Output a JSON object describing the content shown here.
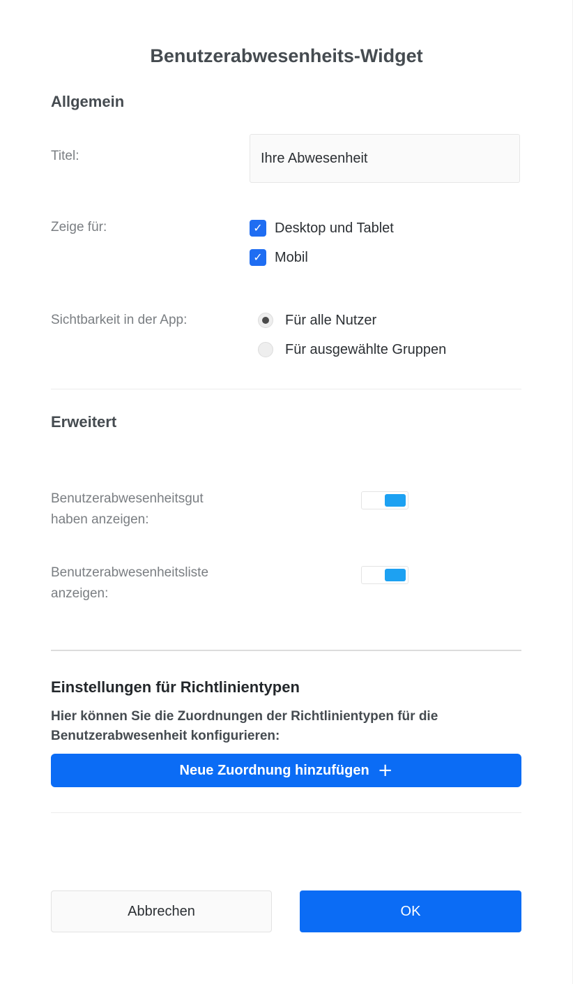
{
  "dialog": {
    "title": "Benutzerabwesenheits-Widget"
  },
  "general": {
    "heading": "Allgemein",
    "title_label": "Titel:",
    "title_value": "Ihre Abwesenheit",
    "show_for_label": "Zeige für:",
    "show_for_options": [
      {
        "label": "Desktop und Tablet",
        "checked": true
      },
      {
        "label": "Mobil",
        "checked": true
      }
    ],
    "visibility_label": "Sichtbarkeit in der App:",
    "visibility_options": [
      {
        "label": "Für alle Nutzer",
        "selected": true
      },
      {
        "label": "Für ausgewählte Gruppen",
        "selected": false
      }
    ]
  },
  "advanced": {
    "heading": "Erweitert",
    "balance_label_line1": "Benutzerabwesenheitsgut",
    "balance_label_line2": "haben anzeigen:",
    "balance_enabled": true,
    "list_label_line1": "Benutzerabwesenheitsliste",
    "list_label_line2": "anzeigen:",
    "list_enabled": true
  },
  "policy": {
    "heading": "Einstellungen für Richtlinientypen",
    "description": "Hier können Sie die Zuordnungen der Richtlinientypen für die Benutzerabwesenheit konfigurieren:",
    "add_button_label": "Neue Zuordnung hinzufügen",
    "add_icon": "plus-icon"
  },
  "footer": {
    "cancel_label": "Abbrechen",
    "ok_label": "OK"
  },
  "colors": {
    "primary": "#0b6cf5",
    "toggle_on": "#1da1f2",
    "checkbox": "#1f6df2"
  }
}
